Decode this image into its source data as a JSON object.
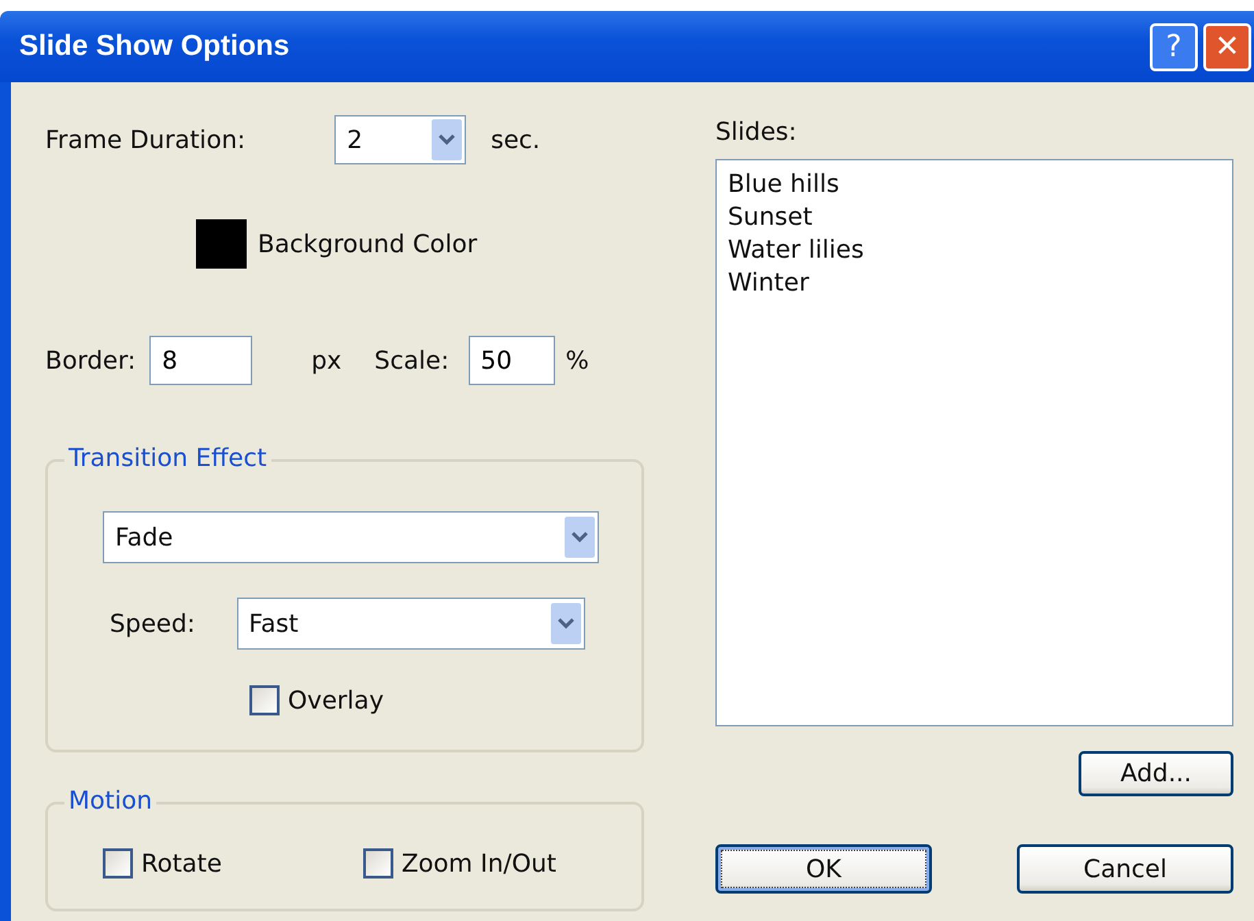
{
  "window": {
    "title": "Slide Show Options",
    "help_button": "?",
    "close_button": "✕"
  },
  "frame_duration": {
    "label": "Frame Duration:",
    "value": "2",
    "unit": "sec."
  },
  "background_color": {
    "label": "Background Color",
    "color": "#000000"
  },
  "border": {
    "label": "Border:",
    "value": "8",
    "unit": "px"
  },
  "scale": {
    "label": "Scale:",
    "value": "50",
    "unit": "%"
  },
  "transition_effect": {
    "legend": "Transition Effect",
    "effect": "Fade",
    "speed_label": "Speed:",
    "speed": "Fast",
    "overlay": {
      "label": "Overlay",
      "checked": false
    }
  },
  "motion": {
    "legend": "Motion",
    "options": [
      {
        "label": "Rotate",
        "checked": false
      },
      {
        "label": "Zoom In/Out",
        "checked": false
      }
    ]
  },
  "slides": {
    "label": "Slides:",
    "items": [
      {
        "name": "Blue hills",
        "selected": false
      },
      {
        "name": "Sunset",
        "selected": false
      },
      {
        "name": "Water lilies",
        "selected": false
      },
      {
        "name": "Winter",
        "selected": false
      }
    ]
  },
  "add_button": "Add...",
  "buttons": [
    {
      "label": "OK",
      "focused": true
    },
    {
      "label": "Cancel",
      "focused": false
    }
  ]
}
